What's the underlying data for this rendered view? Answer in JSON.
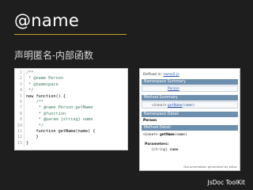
{
  "slide": {
    "title": "@name",
    "subtitle": "声明匿名-内部函数",
    "brand": "JsDoc ToolKit"
  },
  "code": {
    "lines": [
      {
        "n": "1",
        "text": "/**"
      },
      {
        "n": "2",
        "text": " * @name Person"
      },
      {
        "n": "3",
        "text": " * @namespace"
      },
      {
        "n": "4",
        "text": " */"
      },
      {
        "n": "5",
        "text": "new function() {"
      },
      {
        "n": "6",
        "text": "    /**"
      },
      {
        "n": "7",
        "text": "     * @name Person-getName"
      },
      {
        "n": "8",
        "text": "     * @function"
      },
      {
        "n": "9",
        "text": "     * @param {string} name"
      },
      {
        "n": "10",
        "text": "     */"
      },
      {
        "n": "11",
        "text": "    function getName(name) {"
      },
      {
        "n": "12",
        "text": "    }"
      },
      {
        "n": "13",
        "text": "}"
      }
    ]
  },
  "doc": {
    "defined_prefix": "Defined in:",
    "defined_file": "name2.js",
    "namespace_summary": "Namespace Summary",
    "summary_name": "Person",
    "method_summary": "Method Summary",
    "method_static": "<inner>",
    "method_name": "getName",
    "method_params": "(name)",
    "namespace_detail": "Namespace Detail",
    "detail_name": "Person",
    "method_detail": "Method Detail",
    "detail_sig_prefix": "<inner>",
    "detail_sig_name": "getName",
    "detail_sig_params": "(name)",
    "parameters_label": "Parameters:",
    "param_type": "{string}",
    "param_name": "name",
    "footer": "Documentation generated by JsDoc"
  }
}
